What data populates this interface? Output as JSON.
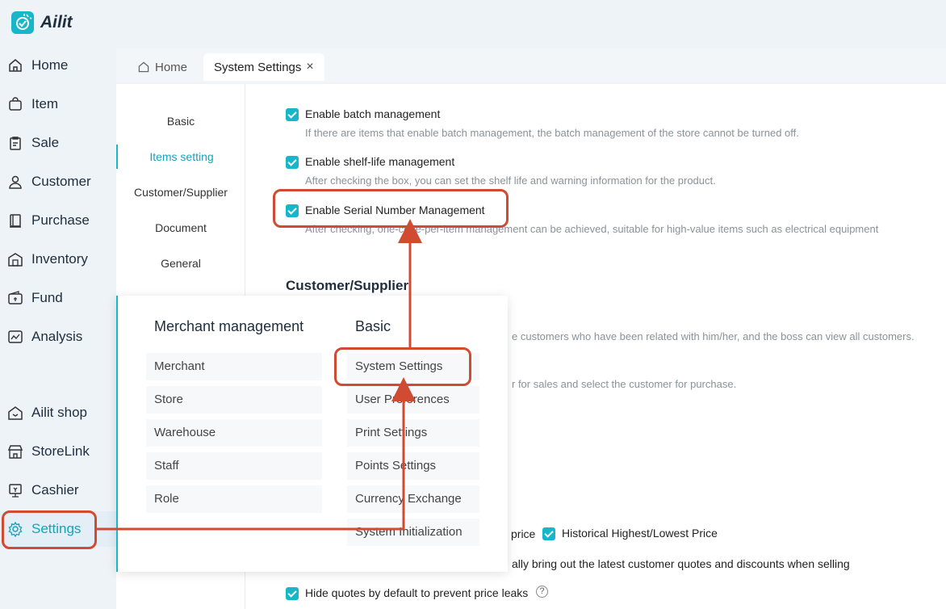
{
  "app": {
    "name": "Ailit"
  },
  "sidebar": {
    "items": [
      {
        "label": "Home",
        "icon": "home-icon"
      },
      {
        "label": "Item",
        "icon": "bag-icon"
      },
      {
        "label": "Sale",
        "icon": "clipboard-icon"
      },
      {
        "label": "Customer",
        "icon": "user-icon"
      },
      {
        "label": "Purchase",
        "icon": "book-icon"
      },
      {
        "label": "Inventory",
        "icon": "warehouse-icon"
      },
      {
        "label": "Fund",
        "icon": "wallet-icon"
      },
      {
        "label": "Analysis",
        "icon": "chart-icon"
      },
      {
        "label": "Ailit shop",
        "icon": "shop-icon"
      },
      {
        "label": "StoreLink",
        "icon": "store-icon"
      },
      {
        "label": "Cashier",
        "icon": "cashier-icon"
      },
      {
        "label": "Settings",
        "icon": "gear-icon"
      }
    ]
  },
  "tabs": {
    "home": "Home",
    "system_settings": "System Settings",
    "close_glyph": "×"
  },
  "settings_nav": [
    "Basic",
    "Items setting",
    "Customer/Supplier",
    "Document",
    "General"
  ],
  "items_setting": {
    "batch": {
      "label": "Enable batch management",
      "desc": "If there are items that enable batch management, the batch management of the store cannot be turned off."
    },
    "shelf": {
      "label": "Enable shelf-life management",
      "desc": "After checking the box, you can set the shelf life and warning information for the product."
    },
    "serial": {
      "label": "Enable Serial Number Management",
      "desc": "After checking, one-code-per-item management can be achieved, suitable for high-value items such as electrical equipment"
    }
  },
  "customer_supplier": {
    "title": "Customer/Supplier",
    "desc1": "e customers who have been related with him/her, and the boss can view all customers.",
    "desc2": "r for sales and select the customer for purchase."
  },
  "price_row": {
    "partial": "price",
    "historical": "Historical Highest/Lowest Price",
    "auto_quotes": "ally bring out the latest customer quotes and discounts when selling",
    "hide_quotes": "Hide quotes by default to prevent price leaks",
    "help_glyph": "?"
  },
  "popup": {
    "merchant_title": "Merchant management",
    "merchant_items": [
      "Merchant",
      "Store",
      "Warehouse",
      "Staff",
      "Role"
    ],
    "basic_title": "Basic",
    "basic_items": [
      "System Settings",
      "User Preferences",
      "Print Settings",
      "Points Settings",
      "Currency Exchange",
      "System Initialization"
    ]
  },
  "colors": {
    "accent": "#17b6c9",
    "highlight": "#d14a32"
  }
}
